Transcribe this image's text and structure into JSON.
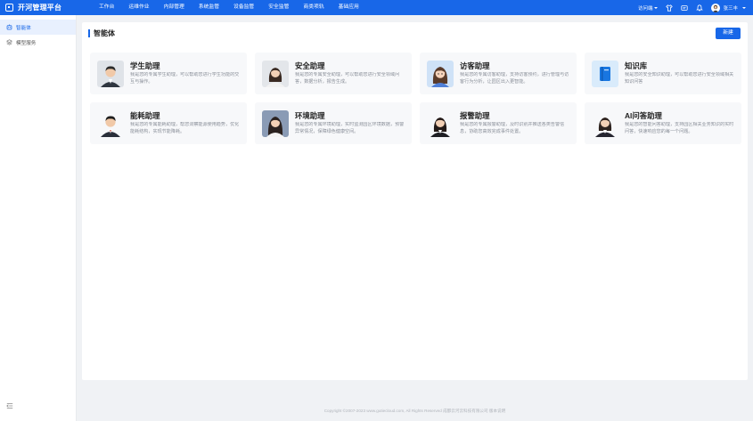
{
  "app": {
    "title": "开河管理平台"
  },
  "nav": [
    "工作台",
    "运维作业",
    "内部管理",
    "系统监管",
    "设备监管",
    "安全监管",
    "商类项轨",
    "基础应用"
  ],
  "topbar": {
    "visit_mode": "访问端",
    "user_name": "张三丰"
  },
  "sidebar": {
    "items": [
      {
        "label": "智能体",
        "icon": "robot-icon",
        "active": true
      },
      {
        "label": "模型服务",
        "icon": "model-icon",
        "active": false
      }
    ]
  },
  "page": {
    "title": "智能体",
    "new_button": "新建"
  },
  "cards": [
    {
      "name": "学生助理",
      "desc": "我是您的专属学生助理，可以帮助您进行学生功能的交互与操作。",
      "avatar": "male-avatar"
    },
    {
      "name": "安全助理",
      "desc": "我是您的专属安全助理，可以帮助您进行安全领域问答，数据分析，报告生成。",
      "avatar": "female-avatar"
    },
    {
      "name": "访客助理",
      "desc": "我是您的专属访客助理，支持访客预约，进行管理与访客行为分析，让园区出入更智能。",
      "avatar": "cartoon-avatar"
    },
    {
      "name": "知识库",
      "desc": "我是您的安全知识助理，可以帮助您进行安全领域相关知识问答",
      "avatar": "book-avatar"
    },
    {
      "name": "能耗助理",
      "desc": "我是您的专属能耗助理，帮您洞察能源使用趋势，优化能耗结构，实现节能降耗。",
      "avatar": "male-avatar"
    },
    {
      "name": "环境助理",
      "desc": "我是您的专属环境助理，实时监测园区环境数据，预警异常情况，保障绿色健康空间。",
      "avatar": "female-avatar"
    },
    {
      "name": "报警助理",
      "desc": "我是您的专属报警助理，及时识别并推送各类告警信息，协助您高效完成事件处置。",
      "avatar": "female-avatar"
    },
    {
      "name": "AI问答助理",
      "desc": "我是您的智能问答助理，支持园区相关业务知识的实时问答，快速响应您的每一个问题。",
      "avatar": "female-avatar"
    }
  ],
  "footer": "Copyright ©2007-2023 www.gutiecloud.com, All Rights Reserved 成都云河云科技有限公司 版本说明",
  "colors": {
    "brand": "#1867e8",
    "card_bg": "#f7f8fa",
    "page_bg": "#f0f2f5"
  }
}
